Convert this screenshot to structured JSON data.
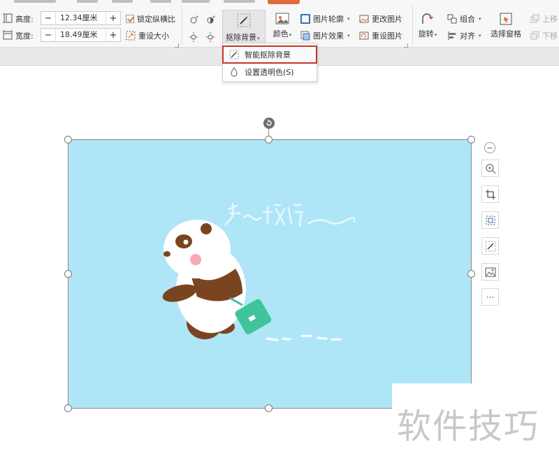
{
  "size_group": {
    "height_label": "高度:",
    "height_value": "12.34厘米",
    "width_label": "宽度:",
    "width_value": "18.49厘米",
    "lock_ratio_label": "锁定纵横比",
    "reset_size_label": "重设大小"
  },
  "adjust_group": {
    "remove_bg_label": "抠除背景",
    "color_label": "颜色"
  },
  "picture_group": {
    "outline_label": "图片轮廓",
    "effects_label": "图片效果",
    "change_label": "更改图片",
    "reset_label": "重设图片"
  },
  "arrange_group": {
    "rotate_label": "旋转",
    "group_label": "组合",
    "align_label": "对齐",
    "selection_pane_label": "选择窗格",
    "bring_forward_label": "上移",
    "send_backward_label": "下移"
  },
  "dropdown": {
    "items": [
      {
        "label": "智能抠除背景",
        "highlighted": true
      },
      {
        "label": "设置透明色(S)",
        "highlighted": false
      }
    ]
  },
  "image": {
    "background_color": "#aee6f8",
    "caption": "空~旅行"
  },
  "side_toolbar": {
    "more_label": "···"
  },
  "watermark": "软件技巧",
  "colors": {
    "accent": "#e06b3a",
    "highlight_outline": "#c0392b"
  }
}
